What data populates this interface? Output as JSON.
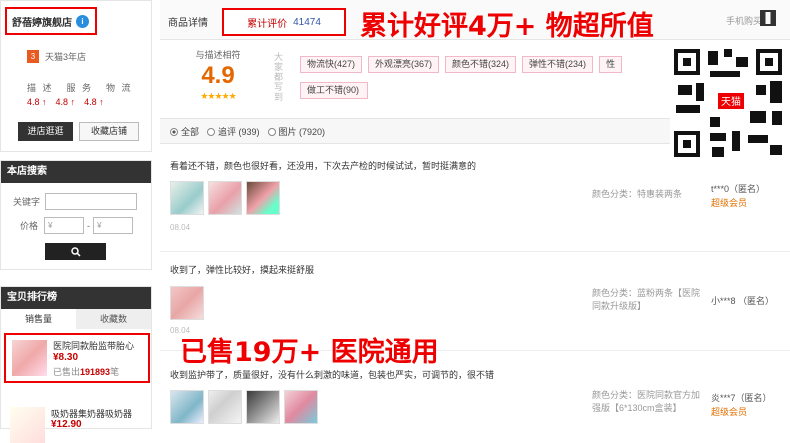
{
  "shop": {
    "name": "舒蓓婷旗舰店",
    "age_badge": "3",
    "age_text": "天猫3年店",
    "dsr_labels": [
      "描 述",
      "服 务",
      "物 流"
    ],
    "dsr_scores": [
      "4.8",
      "4.8",
      "4.8"
    ],
    "enter_btn": "进店逛逛",
    "fav_btn": "收藏店铺"
  },
  "search": {
    "title": "本店搜索",
    "keyword_label": "关键字",
    "price_label": "价格",
    "price_from": "¥",
    "price_to": "¥",
    "dash": "-"
  },
  "ranking": {
    "title": "宝贝排行榜",
    "tabs": [
      "销售量",
      "收藏数"
    ],
    "item1": {
      "title": "医院同款胎监带胎心",
      "price": "¥8.30",
      "sold_prefix": "已售出",
      "sold_count": "191893",
      "sold_unit": "笔"
    },
    "item2": {
      "title": "吸奶器集奶器吸奶器",
      "price": "¥12.90"
    }
  },
  "tabs": {
    "details": "商品详情",
    "reviews_label": "累计评价",
    "reviews_count": "41474",
    "mobile": "手机购买"
  },
  "promo": {
    "top": "累计好评4万+  物超所值",
    "bottom": "已售19万+  医院通用"
  },
  "rating": {
    "label": "与描述相符",
    "score": "4.9",
    "stars": "★★★★★",
    "impression_label": "大家都写到",
    "tags": [
      "物流快(427)",
      "外观漂亮(367)",
      "颜色不错(324)",
      "弹性不错(234)",
      "性",
      "做工不错(90)"
    ]
  },
  "filter": {
    "all": "全部",
    "followup": "追评 (939)",
    "pics": "图片 (7920)"
  },
  "qr_badge": "天猫",
  "reviews": [
    {
      "text": "看着还不错，颜色也很好看，还没用，下次去产检的时候试试，暂时挺满意的",
      "date": "08.04",
      "sku": "颜色分类：特惠装两条",
      "user": "t***0（匿名）",
      "vip": "超级会员"
    },
    {
      "text": "收到了，弹性比较好，摸起来挺舒服",
      "date": "08.04",
      "sku": "颜色分类：蓝粉两条【医院同款升级版】",
      "user": "小***8 （匿名）",
      "vip": ""
    },
    {
      "text": "收到监护带了，质量很好，没有什么刺激的味道，包装也严实，可调节的，很不错",
      "date": "",
      "sku": "颜色分类：医院同款官方加强版【6*130cm盒装】",
      "user": "炎***7（匿名）",
      "vip": "超级会员"
    }
  ]
}
